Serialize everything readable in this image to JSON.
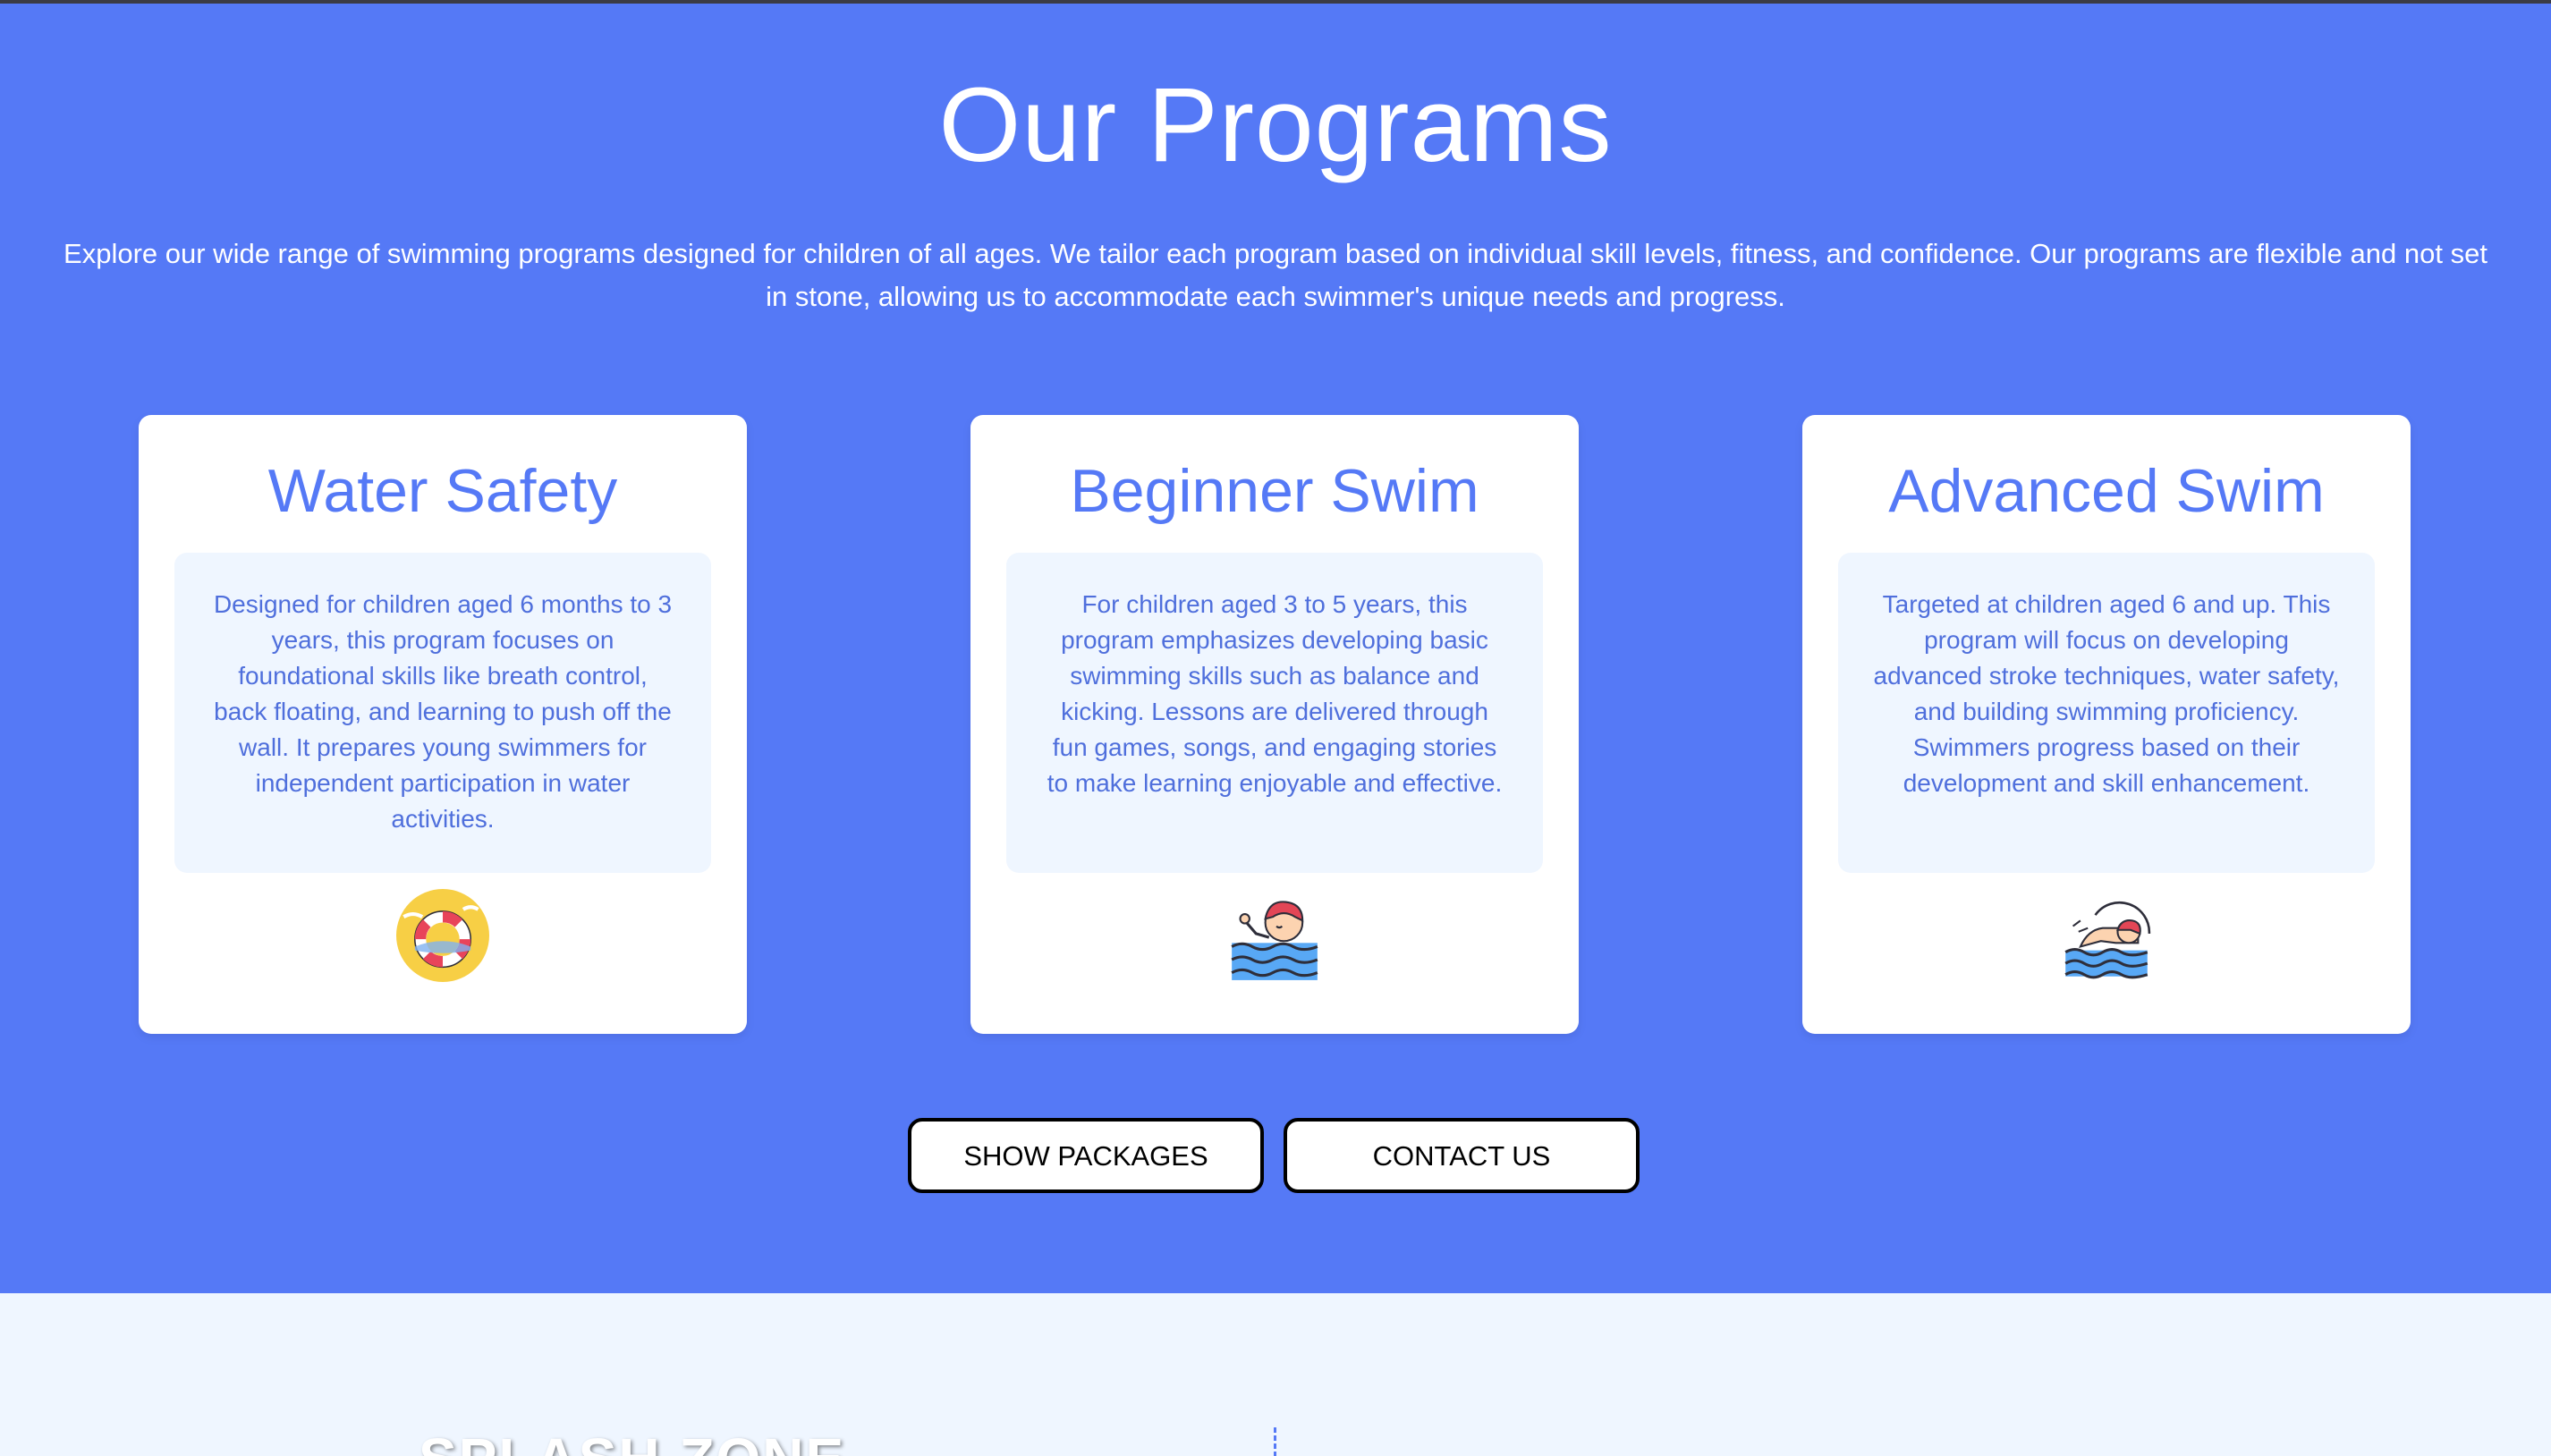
{
  "programs": {
    "title": "Our Programs",
    "intro": "Explore our wide range of swimming programs designed for children of all ages. We tailor each program based on individual skill levels, fitness, and confidence. Our programs are flexible and not set in stone, allowing us to accommodate each swimmer's unique needs and progress.",
    "cards": [
      {
        "title": "Water Safety",
        "description": "Designed for children aged 6 months to 3 years, this program focuses on foundational skills like breath control, back floating, and learning to push off the wall. It prepares young swimmers for independent participation in water activities.",
        "icon": "life-ring-icon"
      },
      {
        "title": "Beginner Swim",
        "description": "For children aged 3 to 5 years, this program emphasizes developing basic swimming skills such as balance and kicking. Lessons are delivered through fun games, songs, and engaging stories to make learning enjoyable and effective.",
        "icon": "child-swimmer-icon"
      },
      {
        "title": "Advanced Swim",
        "description": "Targeted at children aged 6 and up. This program will focus on developing advanced stroke techniques, water safety, and building swimming proficiency. Swimmers progress based on their development and skill enhancement.",
        "icon": "swimmer-icon"
      }
    ],
    "buttons": {
      "show_packages": "SHOW PACKAGES",
      "contact_us": "CONTACT US"
    }
  },
  "splash": {
    "title": "SPLASH ZONE"
  },
  "colors": {
    "section_bg": "#5579f6",
    "card_bg": "#ffffff",
    "description_bg": "#eff6ff",
    "accent": "#5579f6",
    "page_bg": "#eff6ff"
  }
}
